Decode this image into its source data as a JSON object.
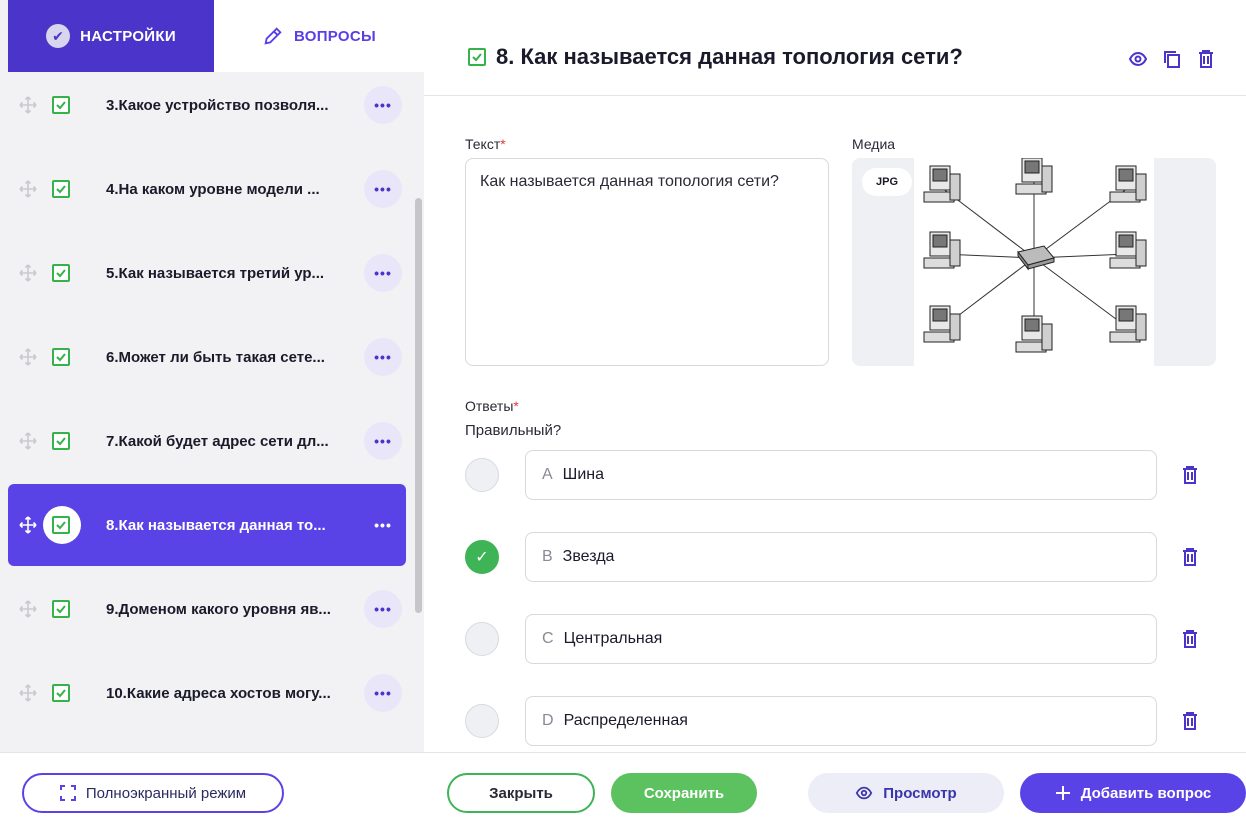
{
  "tabs": {
    "settings": "НАСТРОЙКИ",
    "questions": "ВОПРОСЫ"
  },
  "sidebar": {
    "items": [
      {
        "label": "3.Какое устройство позволя..."
      },
      {
        "label": "4.На каком уровне модели ..."
      },
      {
        "label": "5.Как называется третий ур..."
      },
      {
        "label": "6.Может ли быть такая сете..."
      },
      {
        "label": "7.Какой будет адрес сети дл..."
      },
      {
        "label": "8.Как называется данная то...",
        "active": true
      },
      {
        "label": "9.Доменом какого уровня яв..."
      },
      {
        "label": "10.Какие адреса хостов могу..."
      }
    ],
    "more_label": "•••"
  },
  "question": {
    "title": "8. Как называется данная топология сети?",
    "text_label": "Текст",
    "text_value": "Как называется данная топология сети?",
    "media_label": "Медиа",
    "media_badge": "JPG",
    "answers_label": "Ответы",
    "correct_label": "Правильный?",
    "answers": [
      {
        "letter": "A",
        "text": "Шина",
        "correct": false
      },
      {
        "letter": "B",
        "text": "Звезда",
        "correct": true
      },
      {
        "letter": "C",
        "text": "Центральная",
        "correct": false
      },
      {
        "letter": "D",
        "text": "Распределенная",
        "correct": false
      }
    ],
    "required_mark": "*"
  },
  "footer": {
    "fullscreen": "Полноэкранный режим",
    "close": "Закрыть",
    "save": "Сохранить",
    "preview": "Просмотр",
    "add": "Добавить вопрос"
  },
  "colors": {
    "accent": "#5a43e6",
    "tab_dark": "#4a34c9",
    "green": "#3fb457",
    "required": "#e53935"
  }
}
